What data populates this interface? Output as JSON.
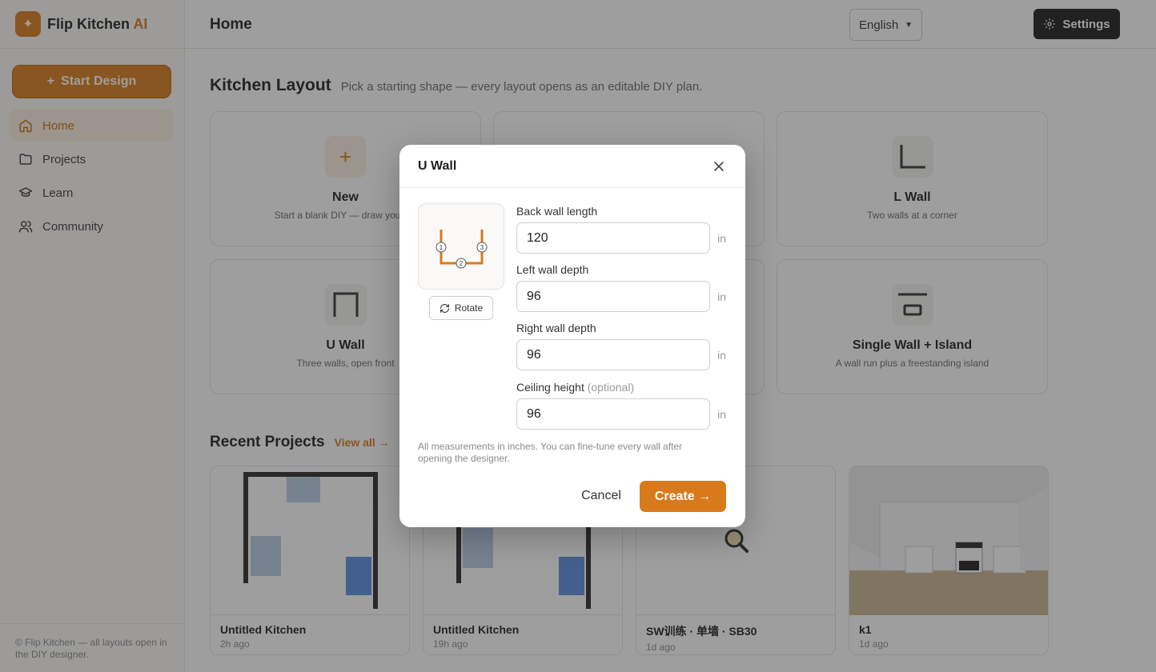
{
  "app": {
    "brand_name": "Flip Kitchen",
    "brand_suffix": "AI",
    "accent_color": "#d97a1a"
  },
  "sidebar": {
    "start_button": "Start Design",
    "items": [
      {
        "label": "Home",
        "icon": "home-icon",
        "active": true
      },
      {
        "label": "Projects",
        "icon": "folder-icon",
        "active": false
      },
      {
        "label": "Learn",
        "icon": "graduation-cap-icon",
        "active": false
      },
      {
        "label": "Community",
        "icon": "users-icon",
        "active": false
      }
    ],
    "footer": "© Flip Kitchen — all layouts open in the DIY designer."
  },
  "header": {
    "title": "Home",
    "language": "English",
    "settings_label": "Settings"
  },
  "kitchen_layout": {
    "title": "Kitchen Layout",
    "subtitle": "Pick a starting shape — every layout opens as an editable DIY plan.",
    "cards": [
      {
        "name": "New",
        "desc": "Start a blank DIY — draw your ov"
      },
      {
        "name": "L Wall",
        "desc": "Two walls at a corner"
      },
      {
        "name": "U Wall",
        "desc": "Three walls, open front"
      },
      {
        "name": "Single Wall + Island",
        "desc": "A wall run plus a freestanding island"
      }
    ]
  },
  "recent": {
    "title": "Recent Projects",
    "view_all": "View all →",
    "projects": [
      {
        "name": "Untitled Kitchen",
        "time": "2h ago"
      },
      {
        "name": "Untitled Kitchen",
        "time": "19h ago"
      },
      {
        "name": "SW训练 · 单墙 · SB30",
        "time": "1d ago"
      },
      {
        "name": "k1",
        "time": "1d ago"
      }
    ]
  },
  "modal": {
    "title": "U Wall",
    "rotate_label": "Rotate",
    "preview_markers": [
      "1",
      "2",
      "3"
    ],
    "fields": {
      "back": {
        "label": "Back wall length",
        "value": "120",
        "unit": "in"
      },
      "left": {
        "label": "Left wall depth",
        "value": "96",
        "unit": "in"
      },
      "right": {
        "label": "Right wall depth",
        "value": "96",
        "unit": "in"
      },
      "ceiling": {
        "label": "Ceiling height",
        "optional": "(optional)",
        "value": "96",
        "unit": "in"
      }
    },
    "note": "All measurements in inches. You can fine-tune every wall after opening the designer.",
    "cancel_label": "Cancel",
    "create_label": "Create →"
  }
}
